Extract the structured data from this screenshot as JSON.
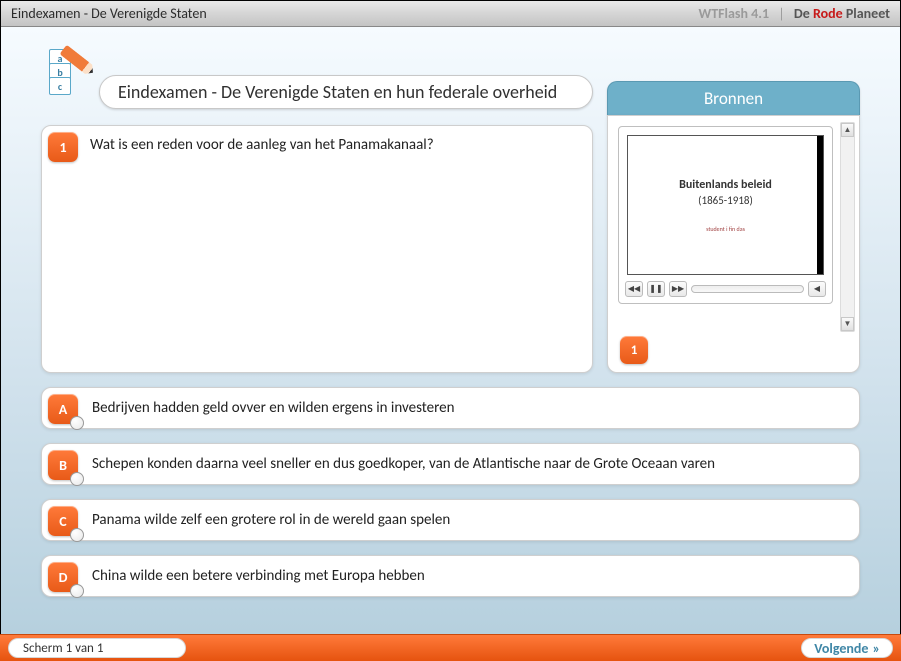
{
  "topbar": {
    "title": "Eindexamen - De Verenigde Staten",
    "app": "WTFlash 4.1",
    "brand_de": "De ",
    "brand_rode": "Rode ",
    "brand_planeet": "Planeet"
  },
  "header": {
    "title": "Eindexamen - De Verenigde Staten en hun federale overheid",
    "bronnen_label": "Bronnen"
  },
  "question": {
    "number": "1",
    "text": "Wat is een reden voor de aanleg van het Panamakanaal?"
  },
  "bronnen": {
    "slide_title": "Buitenlands beleid",
    "slide_subtitle": "(1865-1918)",
    "slide_caption": "student i fin das",
    "badge": "1"
  },
  "answers": [
    {
      "letter": "A",
      "text": "Bedrijven hadden geld ovver en wilden ergens in investeren"
    },
    {
      "letter": "B",
      "text": "Schepen konden daarna veel sneller en dus goedkoper, van de Atlantische naar de Grote Oceaan varen"
    },
    {
      "letter": "C",
      "text": "Panama wilde zelf een grotere rol in de wereld gaan spelen"
    },
    {
      "letter": "D",
      "text": "China wilde een betere verbinding met Europa hebben"
    }
  ],
  "footer": {
    "scherm": "Scherm 1 van 1",
    "volgende": "Volgende",
    "volgende_arrow": "»"
  }
}
